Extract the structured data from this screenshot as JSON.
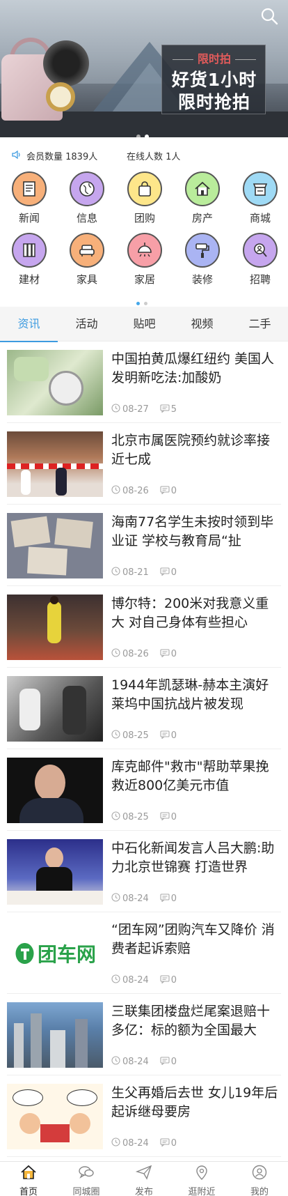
{
  "banner": {
    "tag": "限时拍",
    "line1": "好货1小时",
    "line2": "限时抢拍",
    "dots": 2,
    "active_dot": 1
  },
  "stats": {
    "members": "会员数量 1839人",
    "online": "在线人数 1人"
  },
  "categories": [
    {
      "label": "新闻",
      "icon": "newspaper-icon",
      "color": "#f7b07a"
    },
    {
      "label": "信息",
      "icon": "globe-icon",
      "color": "#c6a6ee"
    },
    {
      "label": "团购",
      "icon": "shopping-bag-icon",
      "color": "#fde68a"
    },
    {
      "label": "房产",
      "icon": "house-icon",
      "color": "#b9ec9b"
    },
    {
      "label": "商城",
      "icon": "shop-icon",
      "color": "#9fdaf5"
    },
    {
      "label": "建材",
      "icon": "building-materials-icon",
      "color": "#c6a6ee"
    },
    {
      "label": "家具",
      "icon": "sofa-icon",
      "color": "#f7b07a"
    },
    {
      "label": "家居",
      "icon": "lamp-icon",
      "color": "#f79fa7"
    },
    {
      "label": "装修",
      "icon": "paint-roller-icon",
      "color": "#aab4f3"
    },
    {
      "label": "招聘",
      "icon": "search-person-icon",
      "color": "#c6a6ee"
    }
  ],
  "tabs": [
    "资讯",
    "活动",
    "贴吧",
    "视频",
    "二手"
  ],
  "active_tab": 0,
  "news": [
    {
      "title": "中国拍黄瓜爆红纽约 美国人发明新吃法:加酸奶",
      "date": "08-27",
      "comments": "5",
      "thumb": "cucumber"
    },
    {
      "title": "北京市属医院预约就诊率接近七成",
      "date": "08-26",
      "comments": "0",
      "thumb": "hospital"
    },
    {
      "title": "海南77名学生未按时领到毕业证 学校与教育局“扯",
      "date": "08-21",
      "comments": "0",
      "thumb": "certificates"
    },
    {
      "title": "博尔特：200米对我意义重大 对自己身体有些担心",
      "date": "08-26",
      "comments": "0",
      "thumb": "sprinter"
    },
    {
      "title": "1944年凯瑟琳-赫本主演好莱坞中国抗战片被发现",
      "date": "08-25",
      "comments": "0",
      "thumb": "oldfilm"
    },
    {
      "title": "库克邮件\"救市\"帮助苹果挽救近800亿美元市值",
      "date": "08-25",
      "comments": "0",
      "thumb": "portrait"
    },
    {
      "title": "中石化新闻发言人吕大鹏:助力北京世锦赛 打造世界",
      "date": "08-24",
      "comments": "0",
      "thumb": "speaker"
    },
    {
      "title": "“团车网”团购汽车又降价 消费者起诉索赔",
      "date": "08-24",
      "comments": "0",
      "thumb": "logo",
      "logo_text": "团车网"
    },
    {
      "title": "三联集团楼盘烂尾案退赔十多亿：标的额为全国最大",
      "date": "08-24",
      "comments": "0",
      "thumb": "city"
    },
    {
      "title": "生父再婚后去世 女儿19年后起诉继母要房",
      "date": "08-24",
      "comments": "0",
      "thumb": "cartoon"
    }
  ],
  "footer": [
    {
      "label": "首页",
      "icon": "home-icon"
    },
    {
      "label": "同城圈",
      "icon": "chat-bubbles-icon"
    },
    {
      "label": "发布",
      "icon": "paper-plane-icon"
    },
    {
      "label": "逛附近",
      "icon": "location-pin-icon"
    },
    {
      "label": "我的",
      "icon": "user-icon"
    }
  ],
  "active_footer": 0,
  "colors": {
    "accent": "#3d9be0",
    "meta": "#999999"
  }
}
